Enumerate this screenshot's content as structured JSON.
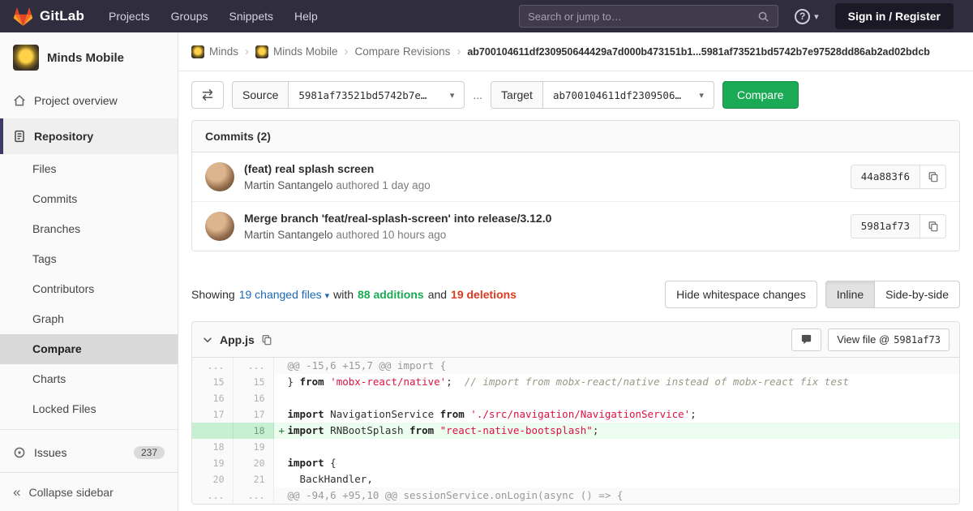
{
  "icons": {
    "help_glyph": "?",
    "caret_down": "▾",
    "breadcrumb_separator": "›",
    "collapse_glyph": "«"
  },
  "navbar": {
    "logo_text": "GitLab",
    "menu": [
      {
        "label": "Projects"
      },
      {
        "label": "Groups"
      },
      {
        "label": "Snippets"
      },
      {
        "label": "Help"
      }
    ],
    "search_placeholder": "Search or jump to…",
    "sign_in_label": "Sign in / Register"
  },
  "sidebar": {
    "project_name": "Minds Mobile",
    "overview_label": "Project overview",
    "repository_label": "Repository",
    "repo_subitems": [
      {
        "label": "Files"
      },
      {
        "label": "Commits"
      },
      {
        "label": "Branches"
      },
      {
        "label": "Tags"
      },
      {
        "label": "Contributors"
      },
      {
        "label": "Graph"
      },
      {
        "label": "Compare"
      },
      {
        "label": "Charts"
      },
      {
        "label": "Locked Files"
      }
    ],
    "issues_label": "Issues",
    "issues_count": "237",
    "collapse_label": "Collapse sidebar"
  },
  "breadcrumb": {
    "group": "Minds",
    "project": "Minds Mobile",
    "page": "Compare Revisions",
    "commit_range": "ab700104611df230950644429a7d000b473151b1...5981af73521bd5742b7e97528dd86ab2ad02bdcb"
  },
  "compare_form": {
    "source_label": "Source",
    "source_value": "5981af73521bd5742b7e…",
    "separator": "...",
    "target_label": "Target",
    "target_value": "ab700104611df2309506…",
    "compare_button": "Compare"
  },
  "commits": {
    "header": "Commits (2)",
    "items": [
      {
        "title": "(feat) real splash screen",
        "author": "Martin Santangelo",
        "meta": "authored",
        "time": "1 day ago",
        "sha": "44a883f6"
      },
      {
        "title": "Merge branch 'feat/real-splash-screen' into release/3.12.0",
        "author": "Martin Santangelo",
        "meta": "authored",
        "time": "10 hours ago",
        "sha": "5981af73"
      }
    ]
  },
  "summary": {
    "showing": "Showing",
    "changed_files": "19 changed files",
    "with_text": "with",
    "additions": "88 additions",
    "and_text": "and",
    "deletions": "19 deletions",
    "hide_whitespace": "Hide whitespace changes",
    "inline": "Inline",
    "side_by_side": "Side-by-side"
  },
  "diff": {
    "filename": "App.js",
    "view_file_prefix": "View file @",
    "view_file_sha": "5981af73",
    "lines": [
      {
        "type": "match",
        "old": "...",
        "new": "...",
        "tokens": [
          {
            "c": "m",
            "t": "@@ -15,6 +15,7 @@ import {"
          }
        ]
      },
      {
        "type": "context",
        "old": "15",
        "new": "15",
        "tokens": [
          {
            "c": "p",
            "t": "} "
          },
          {
            "c": "k",
            "t": "from"
          },
          {
            "c": "p",
            "t": " "
          },
          {
            "c": "s",
            "t": "'mobx-react/native'"
          },
          {
            "c": "p",
            "t": ";  "
          },
          {
            "c": "c",
            "t": "// import from mobx-react/native instead of mobx-react fix test"
          }
        ]
      },
      {
        "type": "context",
        "old": "16",
        "new": "16",
        "tokens": []
      },
      {
        "type": "context",
        "old": "17",
        "new": "17",
        "tokens": [
          {
            "c": "k",
            "t": "import"
          },
          {
            "c": "p",
            "t": " NavigationService "
          },
          {
            "c": "k",
            "t": "from"
          },
          {
            "c": "p",
            "t": " "
          },
          {
            "c": "s",
            "t": "'./src/navigation/NavigationService'"
          },
          {
            "c": "p",
            "t": ";"
          }
        ]
      },
      {
        "type": "addition",
        "old": "",
        "new": "18",
        "sign": "+",
        "tokens": [
          {
            "c": "k",
            "t": "import"
          },
          {
            "c": "p",
            "t": " RNBootSplash "
          },
          {
            "c": "k",
            "t": "from"
          },
          {
            "c": "p",
            "t": " "
          },
          {
            "c": "s",
            "t": "\"react-native-bootsplash\""
          },
          {
            "c": "p",
            "t": ";"
          }
        ]
      },
      {
        "type": "context",
        "old": "18",
        "new": "19",
        "tokens": []
      },
      {
        "type": "context",
        "old": "19",
        "new": "20",
        "tokens": [
          {
            "c": "k",
            "t": "import"
          },
          {
            "c": "p",
            "t": " {"
          }
        ]
      },
      {
        "type": "context",
        "old": "20",
        "new": "21",
        "tokens": [
          {
            "c": "p",
            "t": "  BackHandler,"
          }
        ]
      },
      {
        "type": "match",
        "old": "...",
        "new": "...",
        "tokens": [
          {
            "c": "m",
            "t": "@@ -94,6 +95,10 @@ sessionService.onLogin(async () => {"
          }
        ]
      }
    ]
  }
}
